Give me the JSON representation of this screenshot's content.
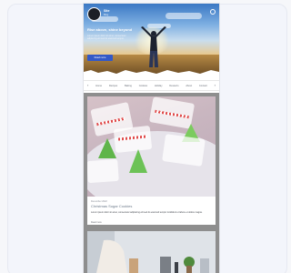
{
  "site": {
    "title": "Site",
    "subtitle": "Blog"
  },
  "hero": {
    "heading": "Rise above, shine beyond",
    "description": "Lorem ipsum dolor sit amet, consectetur adipiscing elit sed do eiusmod tempor.",
    "button_label": "Read more"
  },
  "nav": {
    "items": [
      "Home",
      "Recipes",
      "Baking",
      "Cookies",
      "Holiday",
      "Desserts",
      "About",
      "Contact"
    ]
  },
  "post": {
    "date": "December 2022",
    "title": "Christmas Sugar Cookies",
    "excerpt": "Lorem ipsum dolor sit amet, consectetur adipiscing elit sed do eiusmod tempor incididunt ut labore et dolore magna.",
    "read_more": "Read more"
  },
  "colors": {
    "accent": "#3359c7",
    "feed_background": "#8e8e8e"
  }
}
